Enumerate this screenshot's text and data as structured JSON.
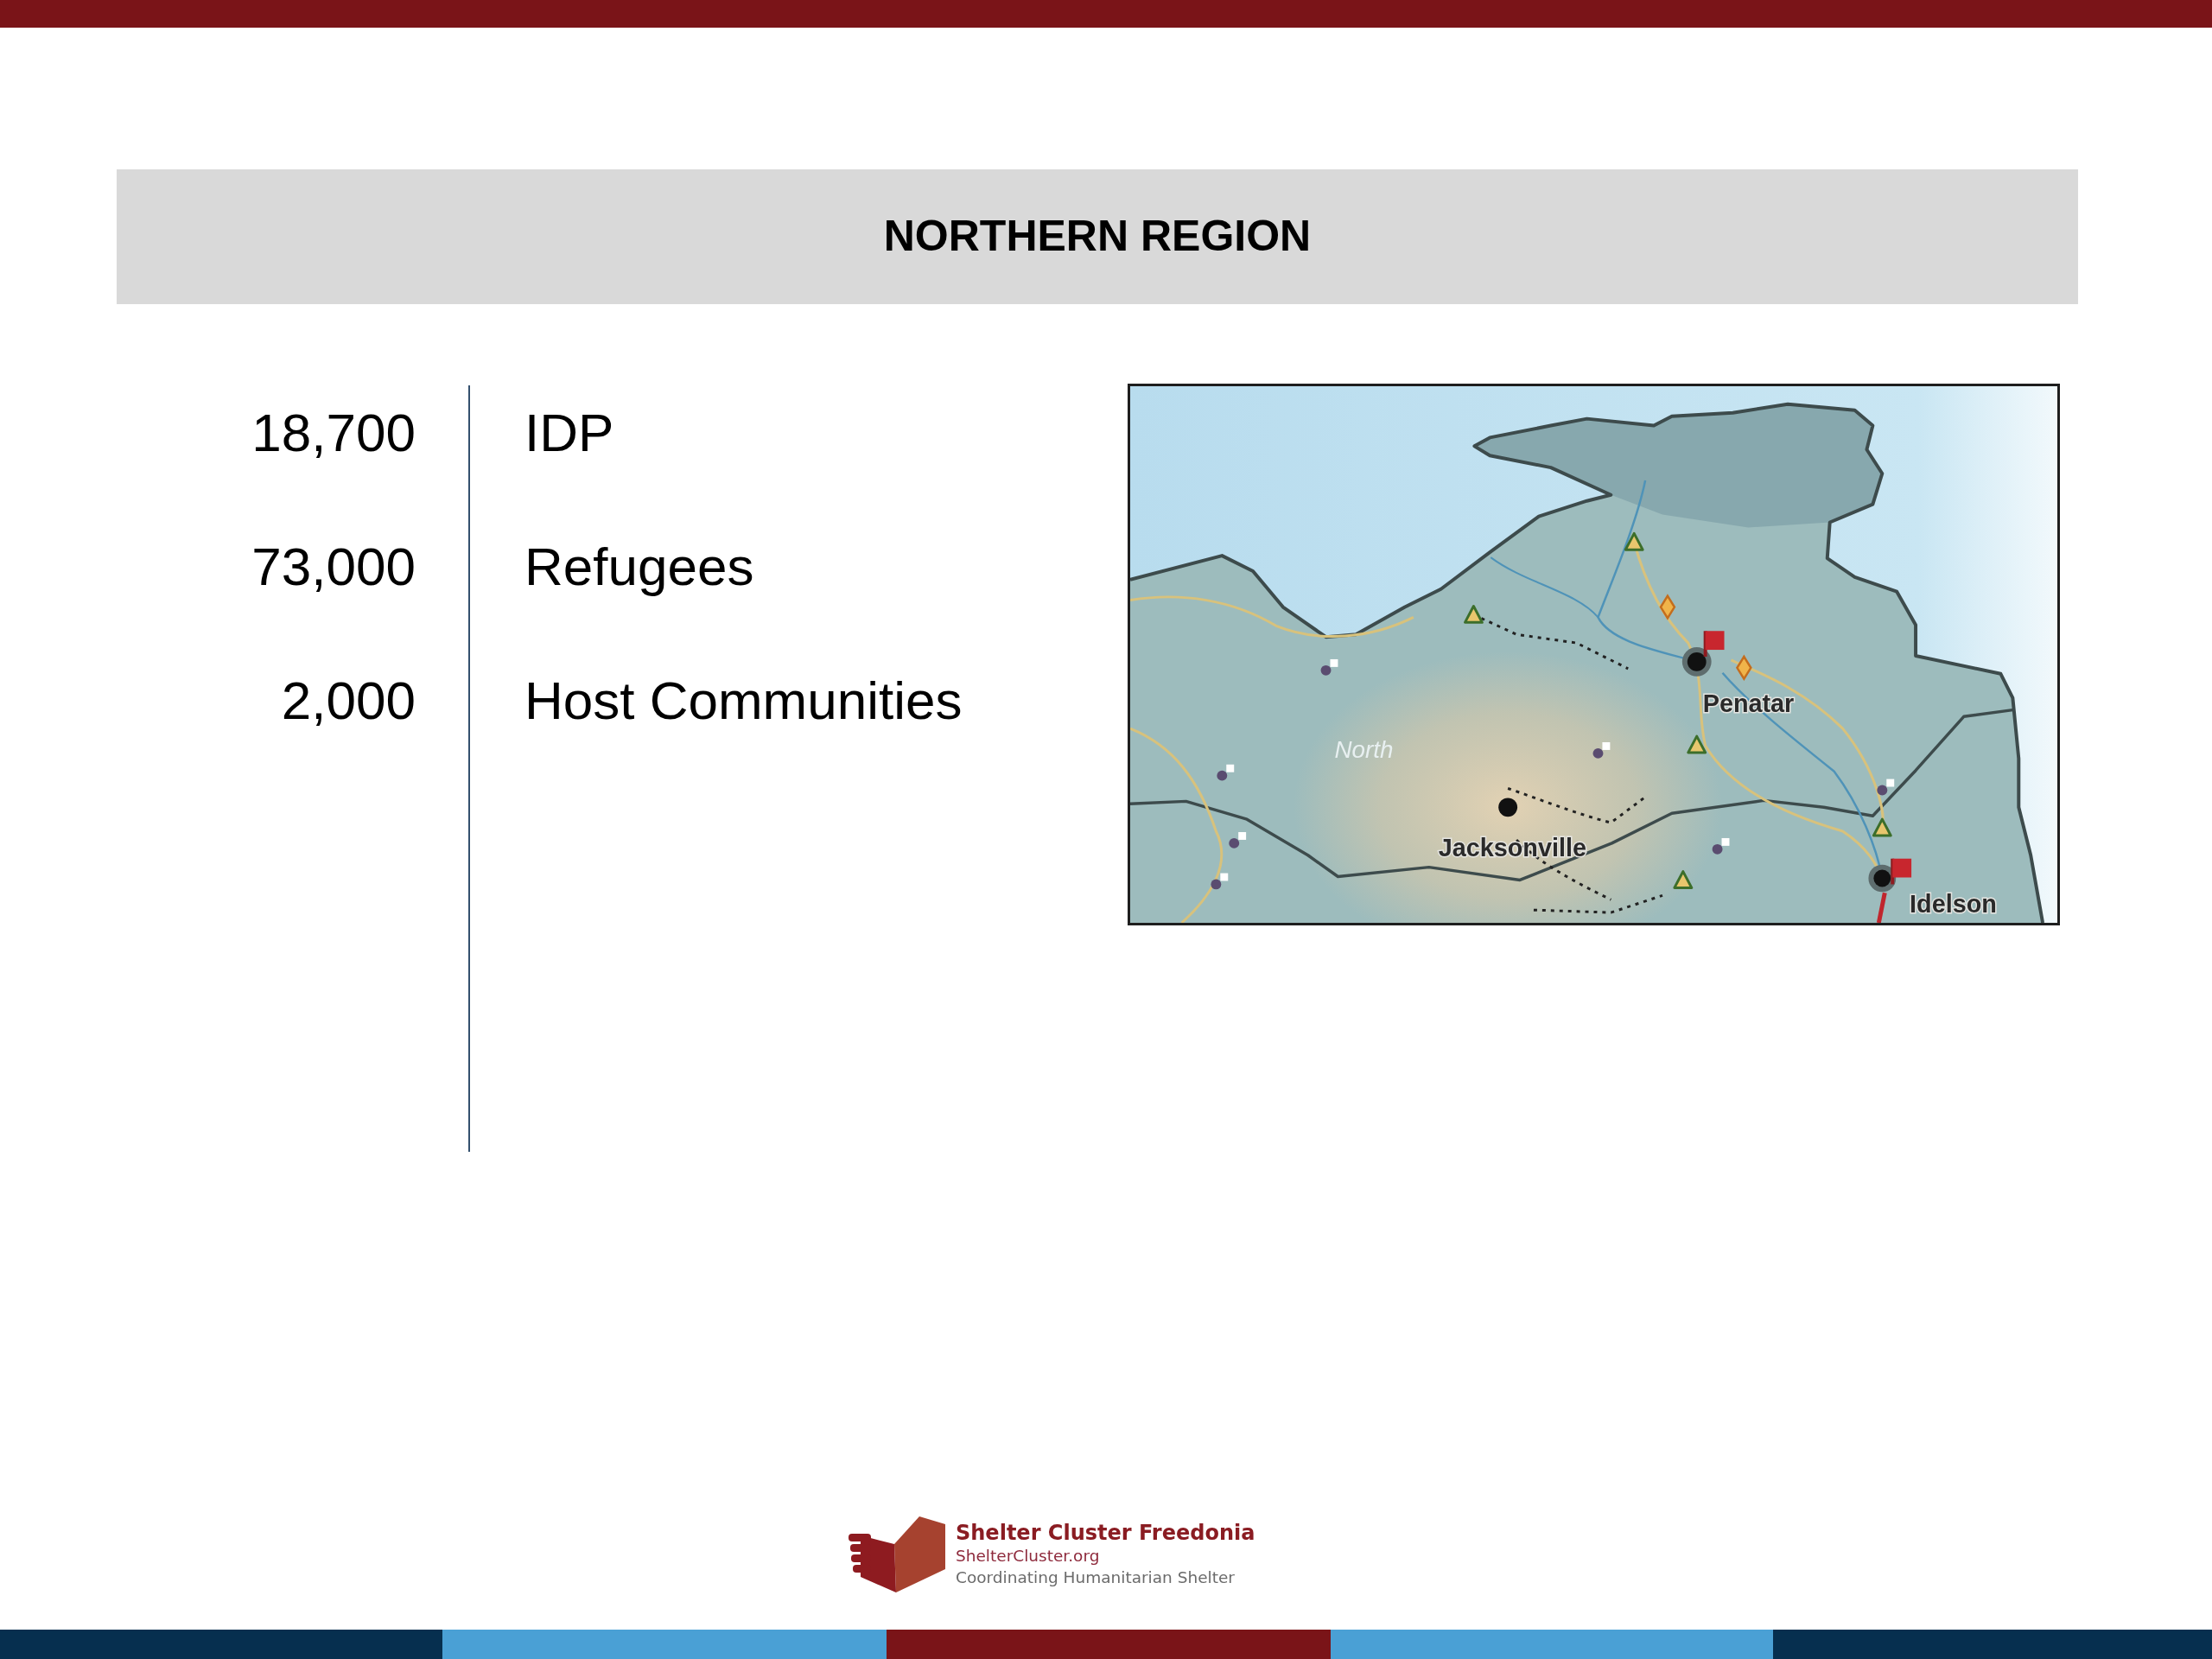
{
  "header": {
    "title": "NORTHERN REGION"
  },
  "stats": [
    {
      "value": "18,700",
      "label": "IDP"
    },
    {
      "value": "73,000",
      "label": "Refugees"
    },
    {
      "value": "2,000",
      "label": "Host Communities"
    }
  ],
  "map": {
    "labels": [
      {
        "text": "Penatar",
        "kind": "city"
      },
      {
        "text": "North",
        "kind": "region"
      },
      {
        "text": "Jacksonville",
        "kind": "city"
      },
      {
        "text": "Idelson",
        "kind": "city"
      }
    ]
  },
  "footer": {
    "logo": {
      "name": "Shelter Cluster Freedonia",
      "website": "ShelterCluster.org",
      "tagline": "Coordinating Humanitarian Shelter"
    }
  }
}
